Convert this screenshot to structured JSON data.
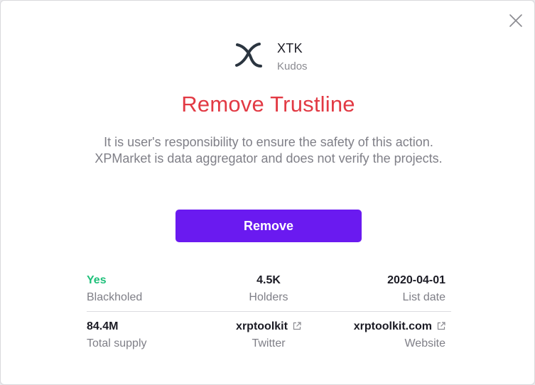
{
  "token": {
    "symbol": "XTK",
    "name": "Kudos",
    "logo_icon": "xtk-logo-icon"
  },
  "dialog": {
    "close_icon": "close-icon",
    "title": "Remove Trustline",
    "warning": "It is user's responsibility to ensure the safety of this action. XPMarket is data aggregator and does not verify the projects.",
    "remove_label": "Remove"
  },
  "stats": {
    "blackholed": {
      "value": "Yes",
      "label": "Blackholed"
    },
    "holders": {
      "value": "4.5K",
      "label": "Holders"
    },
    "list_date": {
      "value": "2020-04-01",
      "label": "List date"
    },
    "total_supply": {
      "value": "84.4M",
      "label": "Total supply"
    },
    "twitter": {
      "value": "xrptoolkit",
      "label": "Twitter",
      "icon": "external-link-icon"
    },
    "website": {
      "value": "xrptoolkit.com",
      "label": "Website",
      "icon": "external-link-icon"
    }
  },
  "colors": {
    "accent": "#6a1af0",
    "danger": "#e23a44",
    "positive": "#1fc07a"
  }
}
